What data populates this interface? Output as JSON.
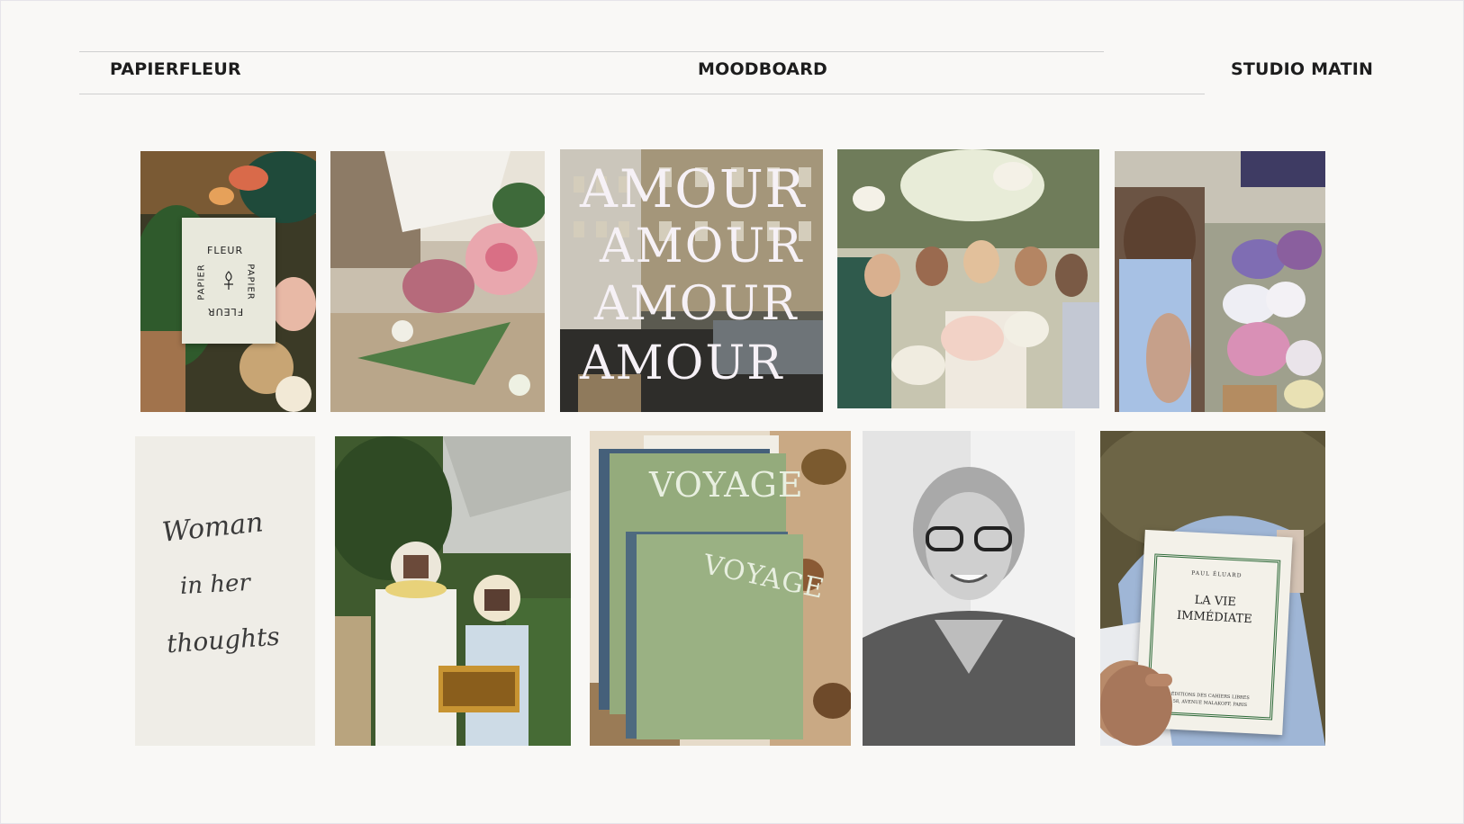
{
  "header": {
    "left": "PAPIERFLEUR",
    "center": "MOODBOARD",
    "right": "STUDIO MATIN"
  },
  "tiles": {
    "logo_card": {
      "line1": "FLEUR",
      "line2": "PAPIER",
      "line3": "PAPIER",
      "line4": "FLEUR"
    },
    "amour": {
      "word": "AMOUR"
    },
    "handwriting": {
      "l1": "Woman",
      "l2": "in her",
      "l3": "thoughts"
    },
    "voyage": {
      "title": "VOYAGE"
    },
    "book": {
      "author": "PAUL ÉLUARD",
      "title1": "LA VIE",
      "title2": "IMMÉDIATE",
      "pub1": "ÉDITIONS DES CAHIERS LIBRES",
      "pub2": "58, AVENUE MALAKOFF, PARIS"
    }
  },
  "colors": {
    "background": "#f9f8f6",
    "text": "#1d1d1d",
    "rule": "#cfcfcf"
  }
}
